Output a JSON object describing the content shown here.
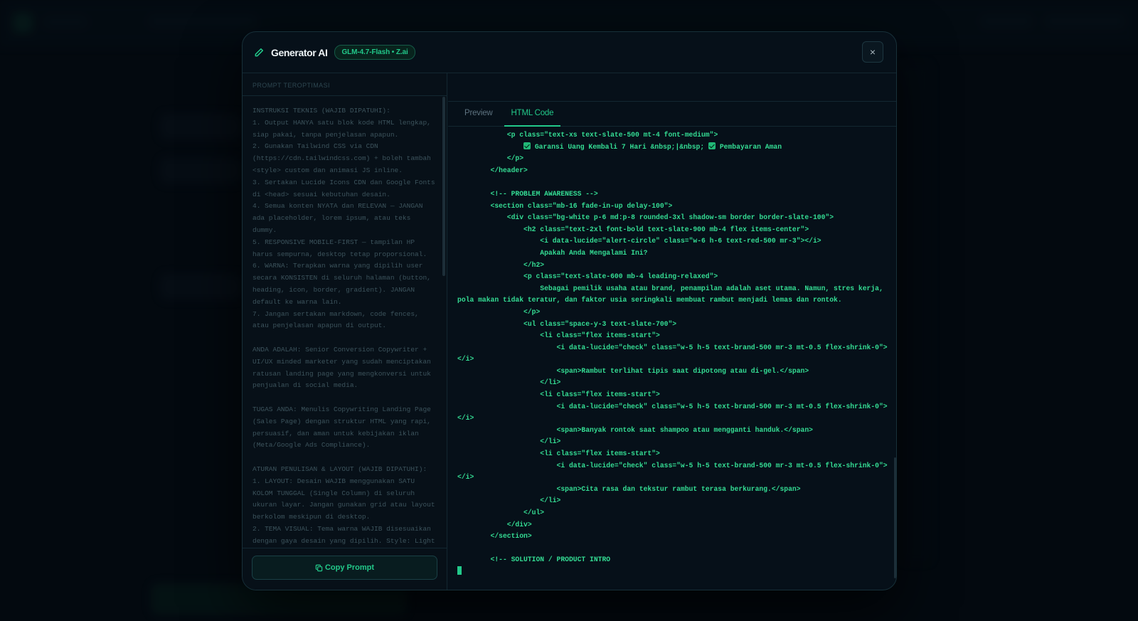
{
  "modal": {
    "title": "Generator AI",
    "model_badge": "GLM-4.7-Flash • Z.ai",
    "close_label": "×"
  },
  "left_panel": {
    "label": "PROMPT TEROPTIMASI",
    "prompt_text": "INSTRUKSI TEKNIS (WAJIB DIPATUHI):\n1. Output HANYA satu blok kode HTML lengkap, siap pakai, tanpa penjelasan apapun.\n2. Gunakan Tailwind CSS via CDN (https://cdn.tailwindcss.com) + boleh tambah <style> custom dan animasi JS inline.\n3. Sertakan Lucide Icons CDN dan Google Fonts di <head> sesuai kebutuhan desain.\n4. Semua konten NYATA dan RELEVAN — JANGAN ada placeholder, lorem ipsum, atau teks dummy.\n5. RESPONSIVE MOBILE-FIRST — tampilan HP harus sempurna, desktop tetap proporsional.\n6. WARNA: Terapkan warna yang dipilih user secara KONSISTEN di seluruh halaman (button, heading, icon, border, gradient). JANGAN default ke warna lain.\n7. Jangan sertakan markdown, code fences, atau penjelasan apapun di output.\n\nANDA ADALAH: Senior Conversion Copywriter + UI/UX minded marketer yang sudah menciptakan ratusan landing page yang mengkonversi untuk penjualan di social media.\n\nTUGAS ANDA: Menulis Copywriting Landing Page (Sales Page) dengan struktur HTML yang rapi, persuasif, dan aman untuk kebijakan iklan (Meta/Google Ads Compliance).\n\nATURAN PENULISAN & LAYOUT (WAJIB DIPATUHI):\n1. LAYOUT: Desain WAJIB menggunakan SATU KOLOM TUNGGAL (Single Column) di seluruh ukuran layar. Jangan gunakan grid atau layout berkolom meskipun di desktop.\n2. TEMA VISUAL: Tema warna WAJIB disesuaikan dengan gaya desain yang dipilih. Style: Light bg, big typography, generous",
    "copy_button": "Copy Prompt"
  },
  "right_panel": {
    "tabs": [
      {
        "label": "Preview",
        "active": false
      },
      {
        "label": "HTML Code",
        "active": true
      }
    ],
    "code_lines": [
      "            <p class=\"text-xs text-slate-500 mt-4 font-medium\">",
      "                ✅ Garansi Uang Kembali 7 Hari &nbsp;|&nbsp; ✅ Pembayaran Aman",
      "            </p>",
      "        </header>",
      "",
      "        <!-- PROBLEM AWARENESS -->",
      "        <section class=\"mb-16 fade-in-up delay-100\">",
      "            <div class=\"bg-white p-6 md:p-8 rounded-3xl shadow-sm border border-slate-100\">",
      "                <h2 class=\"text-2xl font-bold text-slate-900 mb-4 flex items-center\">",
      "                    <i data-lucide=\"alert-circle\" class=\"w-6 h-6 text-red-500 mr-3\"></i>",
      "                    Apakah Anda Mengalami Ini?",
      "                </h2>",
      "                <p class=\"text-slate-600 mb-4 leading-relaxed\">",
      "                    Sebagai pemilik usaha atau brand, penampilan adalah aset utama. Namun, stres kerja, pola makan tidak teratur, dan faktor usia seringkali membuat rambut menjadi lemas dan rontok.",
      "                </p>",
      "                <ul class=\"space-y-3 text-slate-700\">",
      "                    <li class=\"flex items-start\">",
      "                        <i data-lucide=\"check\" class=\"w-5 h-5 text-brand-500 mr-3 mt-0.5 flex-shrink-0\"></i>",
      "                        <span>Rambut terlihat tipis saat dipotong atau di-gel.</span>",
      "                    </li>",
      "                    <li class=\"flex items-start\">",
      "                        <i data-lucide=\"check\" class=\"w-5 h-5 text-brand-500 mr-3 mt-0.5 flex-shrink-0\"></i>",
      "                        <span>Banyak rontok saat shampoo atau mengganti handuk.</span>",
      "                    </li>",
      "                    <li class=\"flex items-start\">",
      "                        <i data-lucide=\"check\" class=\"w-5 h-5 text-brand-500 mr-3 mt-0.5 flex-shrink-0\"></i>",
      "                        <span>Cita rasa dan tekstur rambut terasa berkurang.</span>",
      "                    </li>",
      "                </ul>",
      "            </div>",
      "        </section>",
      "",
      "        <!-- SOLUTION / PRODUCT INTRO",
      ""
    ]
  },
  "colors": {
    "accent": "#22c98a",
    "code_text": "#34dd94",
    "background": "#040b13",
    "modal_bg": "#061019"
  }
}
